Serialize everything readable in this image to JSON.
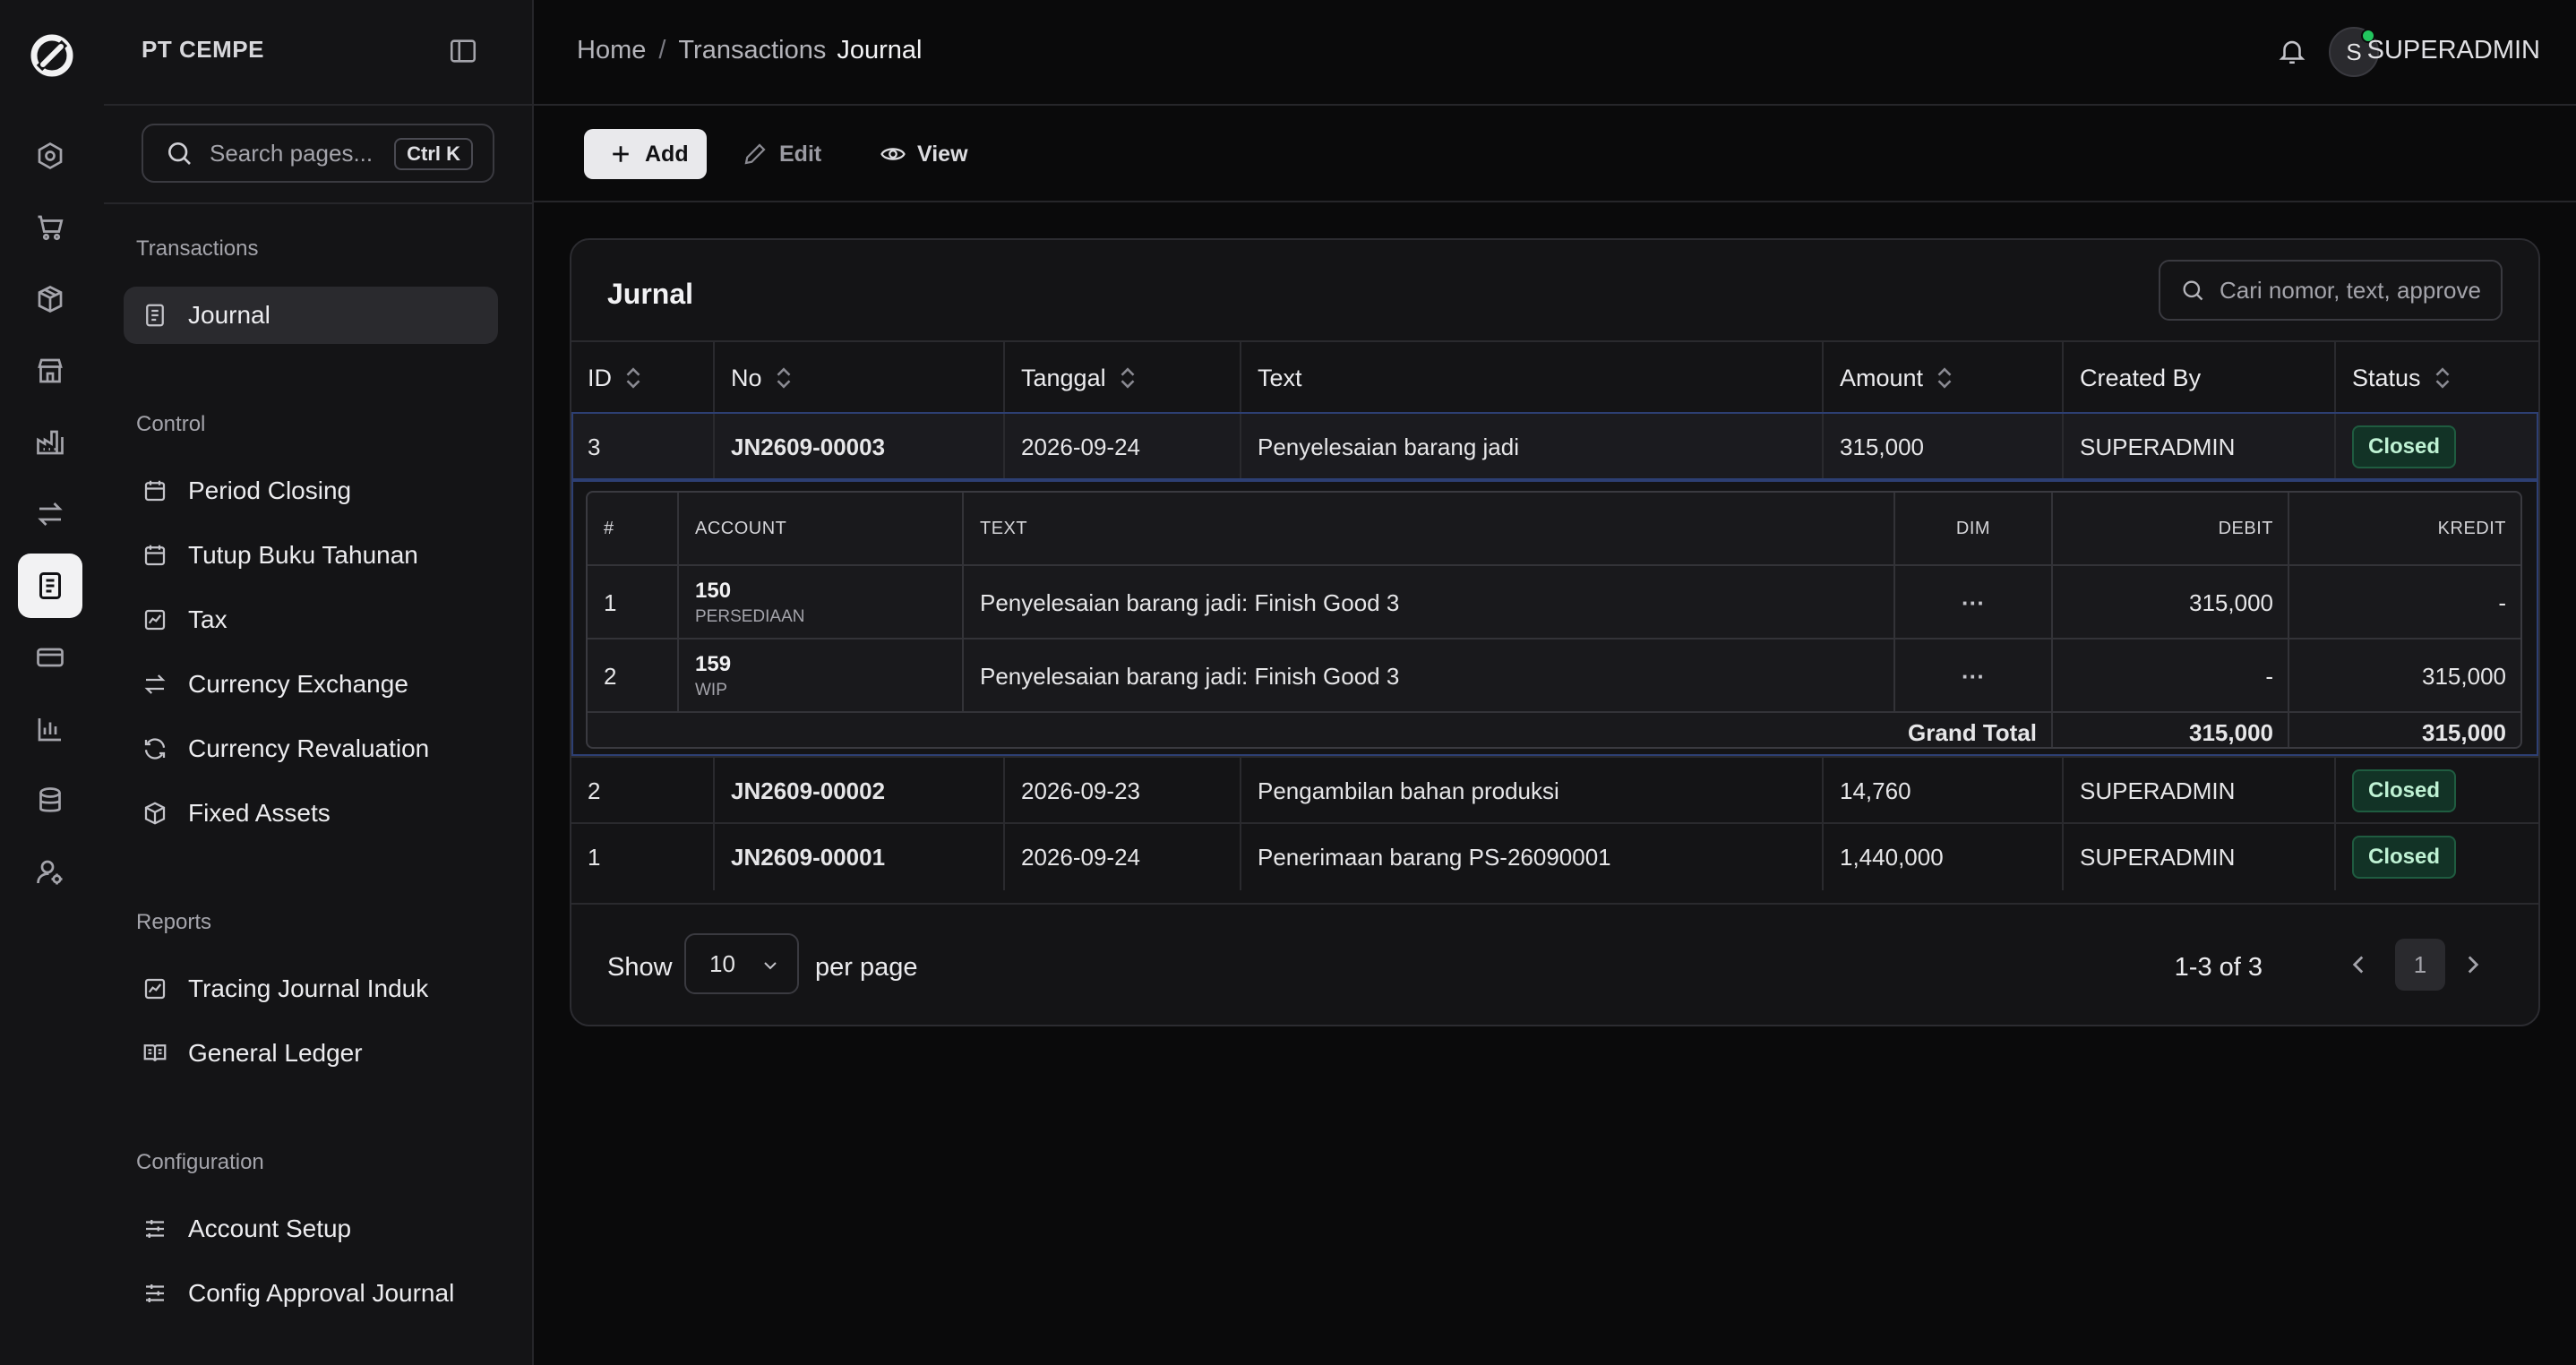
{
  "app": {
    "org_name": "PT CEMPE"
  },
  "rail": {
    "icons": [
      "logo-icon",
      "dashboard-icon",
      "cart-icon",
      "package-icon",
      "store-icon",
      "factory-icon",
      "transfer-icon",
      "journal-icon",
      "card-icon",
      "chart-icon",
      "database-icon",
      "user-settings-icon"
    ],
    "active": "journal-icon"
  },
  "sidebar": {
    "search_placeholder": "Search pages...",
    "search_shortcut": "Ctrl K",
    "sections": [
      {
        "title": "Transactions",
        "items": [
          {
            "label": "Journal",
            "icon": "journal-icon",
            "active": true
          }
        ]
      },
      {
        "title": "Control",
        "items": [
          {
            "label": "Period Closing",
            "icon": "calendar-icon"
          },
          {
            "label": "Tutup Buku Tahunan",
            "icon": "calendar-icon"
          },
          {
            "label": "Tax",
            "icon": "receipt-icon"
          },
          {
            "label": "Currency Exchange",
            "icon": "exchange-icon"
          },
          {
            "label": "Currency Revaluation",
            "icon": "refresh-icon"
          },
          {
            "label": "Fixed Assets",
            "icon": "package-icon"
          }
        ]
      },
      {
        "title": "Reports",
        "items": [
          {
            "label": "Tracing Journal Induk",
            "icon": "trend-icon"
          },
          {
            "label": "General Ledger",
            "icon": "book-icon"
          }
        ]
      },
      {
        "title": "Configuration",
        "items": [
          {
            "label": "Account Setup",
            "icon": "sliders-icon"
          },
          {
            "label": "Config Approval Journal",
            "icon": "sliders-icon"
          }
        ]
      }
    ]
  },
  "header": {
    "breadcrumb": [
      "Home",
      "Transactions"
    ],
    "breadcrumb_separator": "/",
    "current": "Journal",
    "avatar_initial": "S",
    "username": "SUPERADMIN"
  },
  "toolbar": {
    "add_label": "Add",
    "edit_label": "Edit",
    "view_label": "View"
  },
  "table": {
    "title": "Jurnal",
    "search_placeholder": "Cari nomor, text, approve",
    "columns": [
      "ID",
      "No",
      "Tanggal",
      "Text",
      "Amount",
      "Created By",
      "Status"
    ],
    "rows": [
      {
        "id": "3",
        "no": "JN2609-00003",
        "tanggal": "2026-09-24",
        "text": "Penyelesaian barang jadi",
        "amount": "315,000",
        "created_by": "SUPERADMIN",
        "status": "Closed"
      },
      {
        "id": "2",
        "no": "JN2609-00002",
        "tanggal": "2026-09-23",
        "text": "Pengambilan bahan produksi",
        "amount": "14,760",
        "created_by": "SUPERADMIN",
        "status": "Closed"
      },
      {
        "id": "1",
        "no": "JN2609-00001",
        "tanggal": "2026-09-24",
        "text": "Penerimaan barang PS-26090001",
        "amount": "1,440,000",
        "created_by": "SUPERADMIN",
        "status": "Closed"
      }
    ],
    "detail": {
      "columns": [
        "#",
        "ACCOUNT",
        "TEXT",
        "DIM",
        "DEBIT",
        "KREDIT"
      ],
      "lines": [
        {
          "n": "1",
          "account_code": "150",
          "account_name": "PERSEDIAAN",
          "text": "Penyelesaian barang jadi: Finish Good 3",
          "dim": "···",
          "debit": "315,000",
          "kredit": "-"
        },
        {
          "n": "2",
          "account_code": "159",
          "account_name": "WIP",
          "text": "Penyelesaian barang jadi: Finish Good 3",
          "dim": "···",
          "debit": "-",
          "kredit": "315,000"
        }
      ],
      "grand_total_label": "Grand Total",
      "grand_total_debit": "315,000",
      "grand_total_kredit": "315,000"
    },
    "pagination": {
      "show_label": "Show",
      "per_page_value": "10",
      "per_page_label": "per page",
      "range": "1-3 of 3",
      "current_page": "1"
    }
  },
  "colors": {
    "background": "#0a0a0b",
    "panel": "#141416",
    "status_closed_bg": "#123326",
    "status_closed_text": "#bff2d4",
    "selection_border": "#2d3f73"
  }
}
